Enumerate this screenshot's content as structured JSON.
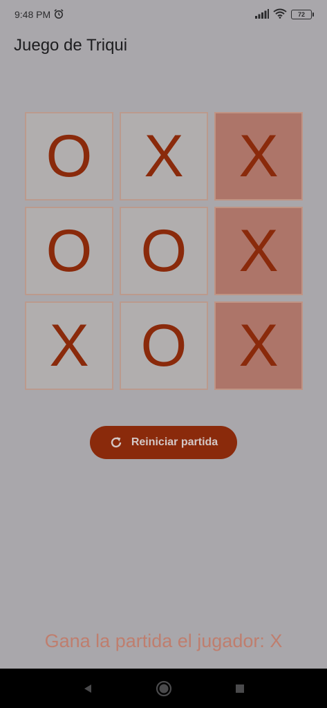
{
  "status_bar": {
    "time": "9:48 PM",
    "alarm_icon": "alarm-clock-icon",
    "signal_icon": "signal-icon",
    "wifi_icon": "wifi-icon",
    "battery_level": "72"
  },
  "app": {
    "title": "Juego de Triqui"
  },
  "board": {
    "cells": [
      "O",
      "X",
      "X",
      "O",
      "O",
      "X",
      "X",
      "O",
      "X"
    ],
    "winning_cells": [
      2,
      5,
      8
    ]
  },
  "actions": {
    "reset_label": "Reiniciar partida",
    "reset_icon": "refresh-icon"
  },
  "result": {
    "message": "Gana la partida el jugador: X"
  },
  "colors": {
    "accent": "#8a2a0b",
    "background": "#a9a7ab",
    "win_cell": "#ad7569",
    "result_text": "#bf7e6e"
  },
  "nav": {
    "back_icon": "back-triangle-icon",
    "home_icon": "home-circle-icon",
    "recents_icon": "recents-square-icon"
  }
}
